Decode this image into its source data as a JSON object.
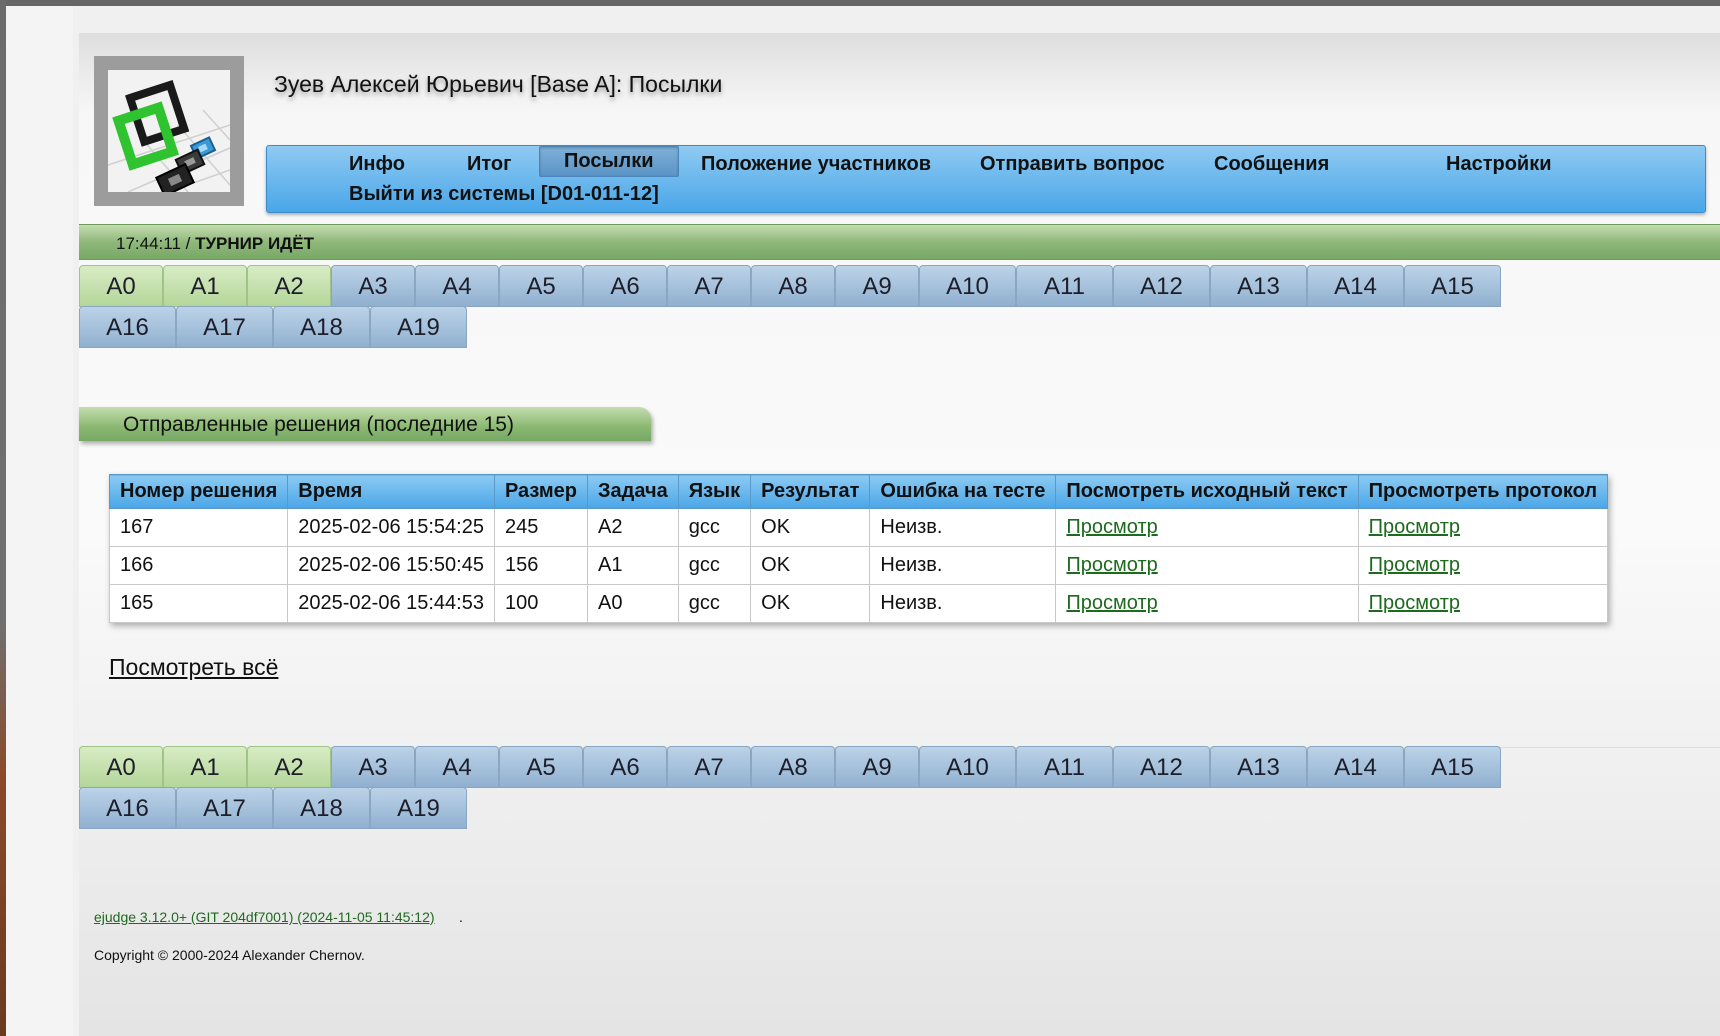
{
  "header": {
    "title": "Зуев Алексей Юрьевич [Base A]: Посылки"
  },
  "menu": {
    "items": [
      {
        "label": "Инфо"
      },
      {
        "label": "Итог"
      },
      {
        "label": "Посылки",
        "active": true
      },
      {
        "label": "Положение участников"
      },
      {
        "label": "Отправить вопрос"
      },
      {
        "label": "Сообщения"
      },
      {
        "label": "Настройки"
      },
      {
        "label": "Выйти из системы [D01-011-12]"
      }
    ]
  },
  "status": {
    "time": "17:44:11 / ",
    "state": "ТУРНИР ИДЁТ"
  },
  "problems": [
    "A0",
    "A1",
    "A2",
    "A3",
    "A4",
    "A5",
    "A6",
    "A7",
    "A8",
    "A9",
    "A10",
    "A11",
    "A12",
    "A13",
    "A14",
    "A15",
    "A16",
    "A17",
    "A18",
    "A19"
  ],
  "solved_problems": [
    "A0",
    "A1",
    "A2"
  ],
  "section": {
    "title": "Отправленные решения (последние 15)"
  },
  "runs_table": {
    "headers": [
      "Номер решения",
      "Время",
      "Размер",
      "Задача",
      "Язык",
      "Результат",
      "Ошибка на тесте",
      "Посмотреть исходный текст",
      "Просмотреть протокол"
    ],
    "rows": [
      {
        "id": "167",
        "time": "2025-02-06 15:54:25",
        "size": "245",
        "problem": "A2",
        "lang": "gcc",
        "result": "OK",
        "failed_test": "Неизв.",
        "source_link": "Просмотр",
        "report_link": "Просмотр"
      },
      {
        "id": "166",
        "time": "2025-02-06 15:50:45",
        "size": "156",
        "problem": "A1",
        "lang": "gcc",
        "result": "OK",
        "failed_test": "Неизв.",
        "source_link": "Просмотр",
        "report_link": "Просмотр"
      },
      {
        "id": "165",
        "time": "2025-02-06 15:44:53",
        "size": "100",
        "problem": "A0",
        "lang": "gcc",
        "result": "OK",
        "failed_test": "Неизв.",
        "source_link": "Просмотр",
        "report_link": "Просмотр"
      }
    ]
  },
  "view_all": "Посмотреть всё",
  "footer": {
    "version_link": "ejudge 3.12.0+ (GIT 204df7001) (2024-11-05 11:45:12)",
    "version_suffix": ".",
    "copyright": "Copyright © 2000-2024 Alexander Chernov."
  },
  "colors": {
    "menu_blue": "#4aa6e8",
    "status_green": "#8fb97a",
    "solved_tab": "#b4d69a",
    "unsolved_tab": "#90b0d0",
    "link_green": "#1e6a1e"
  }
}
